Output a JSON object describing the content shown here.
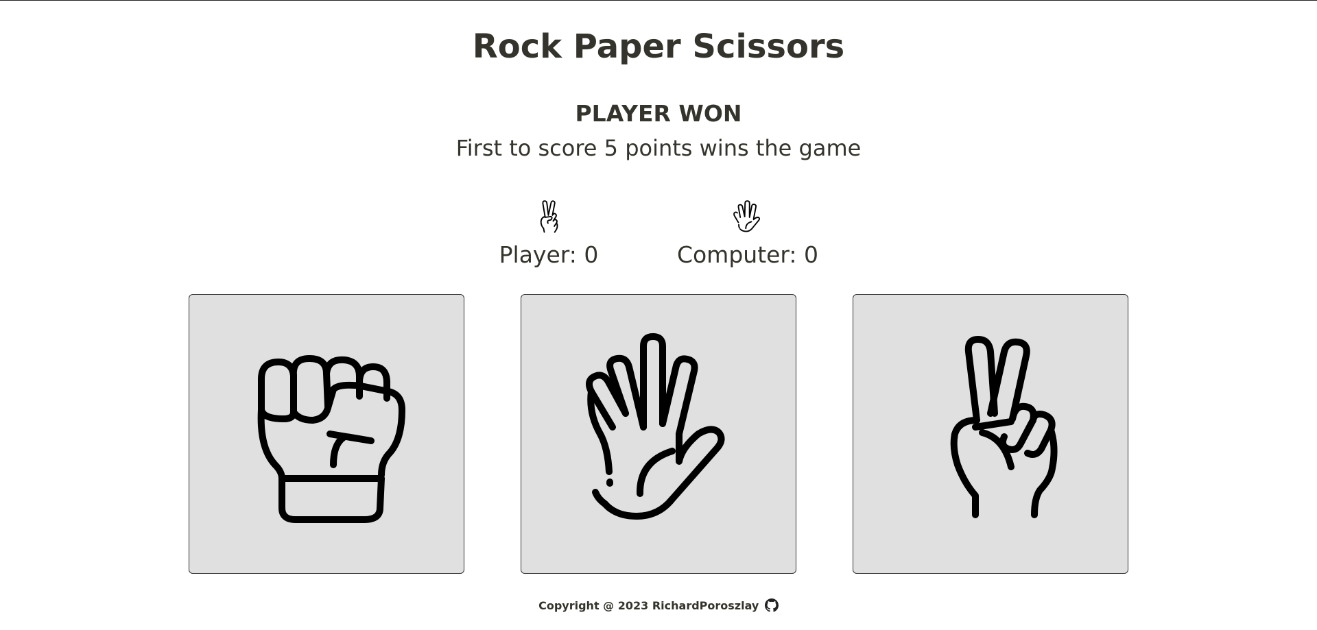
{
  "header": {
    "title": "Rock Paper Scissors"
  },
  "status": {
    "result": "PLAYER WON",
    "rules": "First to score 5 points wins the game"
  },
  "scoreboard": {
    "player": {
      "label": "Player: 0",
      "last_choice_icon": "scissors-icon"
    },
    "computer": {
      "label": "Computer: 0",
      "last_choice_icon": "paper-icon"
    }
  },
  "choices": [
    {
      "name": "rock",
      "icon": "rock-fist-icon"
    },
    {
      "name": "paper",
      "icon": "paper-open-hand-icon"
    },
    {
      "name": "scissors",
      "icon": "scissors-victory-hand-icon"
    }
  ],
  "footer": {
    "copyright": "Copyright @ 2023 RichardPoroszlay",
    "link_icon": "github-icon"
  },
  "colors": {
    "background": "#ffffff",
    "text": "#34332c",
    "card_background": "#e0e0e0",
    "card_border": "#333333"
  }
}
